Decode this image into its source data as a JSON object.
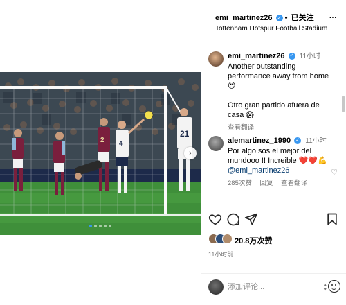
{
  "post": {
    "username": "emi_martinez26",
    "follow_status": "已关注",
    "location": "Tottenham Hotspur Football Stadium",
    "dot_separator": "•",
    "carousel": {
      "slide_count": 5,
      "active_index": 0,
      "next_icon": "chevron-right-icon"
    }
  },
  "comments": [
    {
      "username": "emi_martinez26",
      "verified": true,
      "time": "11小时",
      "text": "Another outstanding performance away from home 😍\n\nOtro gran partido afuera de casa 😱",
      "translate_label": "查看翻译"
    },
    {
      "username": "alemartinez_1990",
      "verified": true,
      "time": "11小时",
      "text": "Por algo sos el mejor del mundooo !! Increible ❤️❤️💪",
      "mention": "@emi_martinez26",
      "likes_label": "285次赞",
      "reply_label": "回复",
      "translate_label": "查看翻译"
    }
  ],
  "actions": {
    "like_icon": "heart-icon",
    "comment_icon": "comment-icon",
    "share_icon": "share-icon",
    "save_icon": "bookmark-icon"
  },
  "likes": {
    "count_label": "20.8万次赞",
    "timeago": "11小时前"
  },
  "add_comment": {
    "placeholder": "添加评论..."
  },
  "colors": {
    "accent": "#3897f0",
    "pitch": "#3f8f3a",
    "villa_claret": "#7a1f3d",
    "spurs_white": "#f3f3f3"
  }
}
